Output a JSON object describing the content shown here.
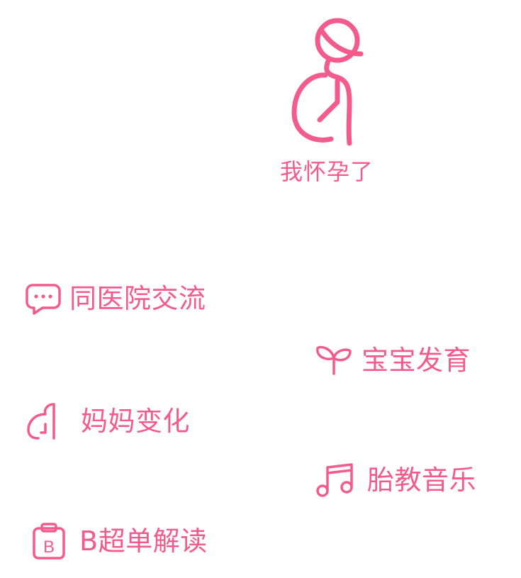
{
  "hero": {
    "icon": "pregnant-woman-icon",
    "label": "我怀孕了"
  },
  "features": [
    {
      "icon": "chat-bubble-icon",
      "label": "同医院交流"
    },
    {
      "icon": "sprout-icon",
      "label": "宝宝发育"
    },
    {
      "icon": "pregnant-belly-icon",
      "label": "妈妈变化"
    },
    {
      "icon": "music-note-icon",
      "label": "胎教音乐"
    },
    {
      "icon": "clipboard-b-icon",
      "label": "B超单解读"
    }
  ],
  "colors": {
    "accent": "#f25b8b"
  }
}
